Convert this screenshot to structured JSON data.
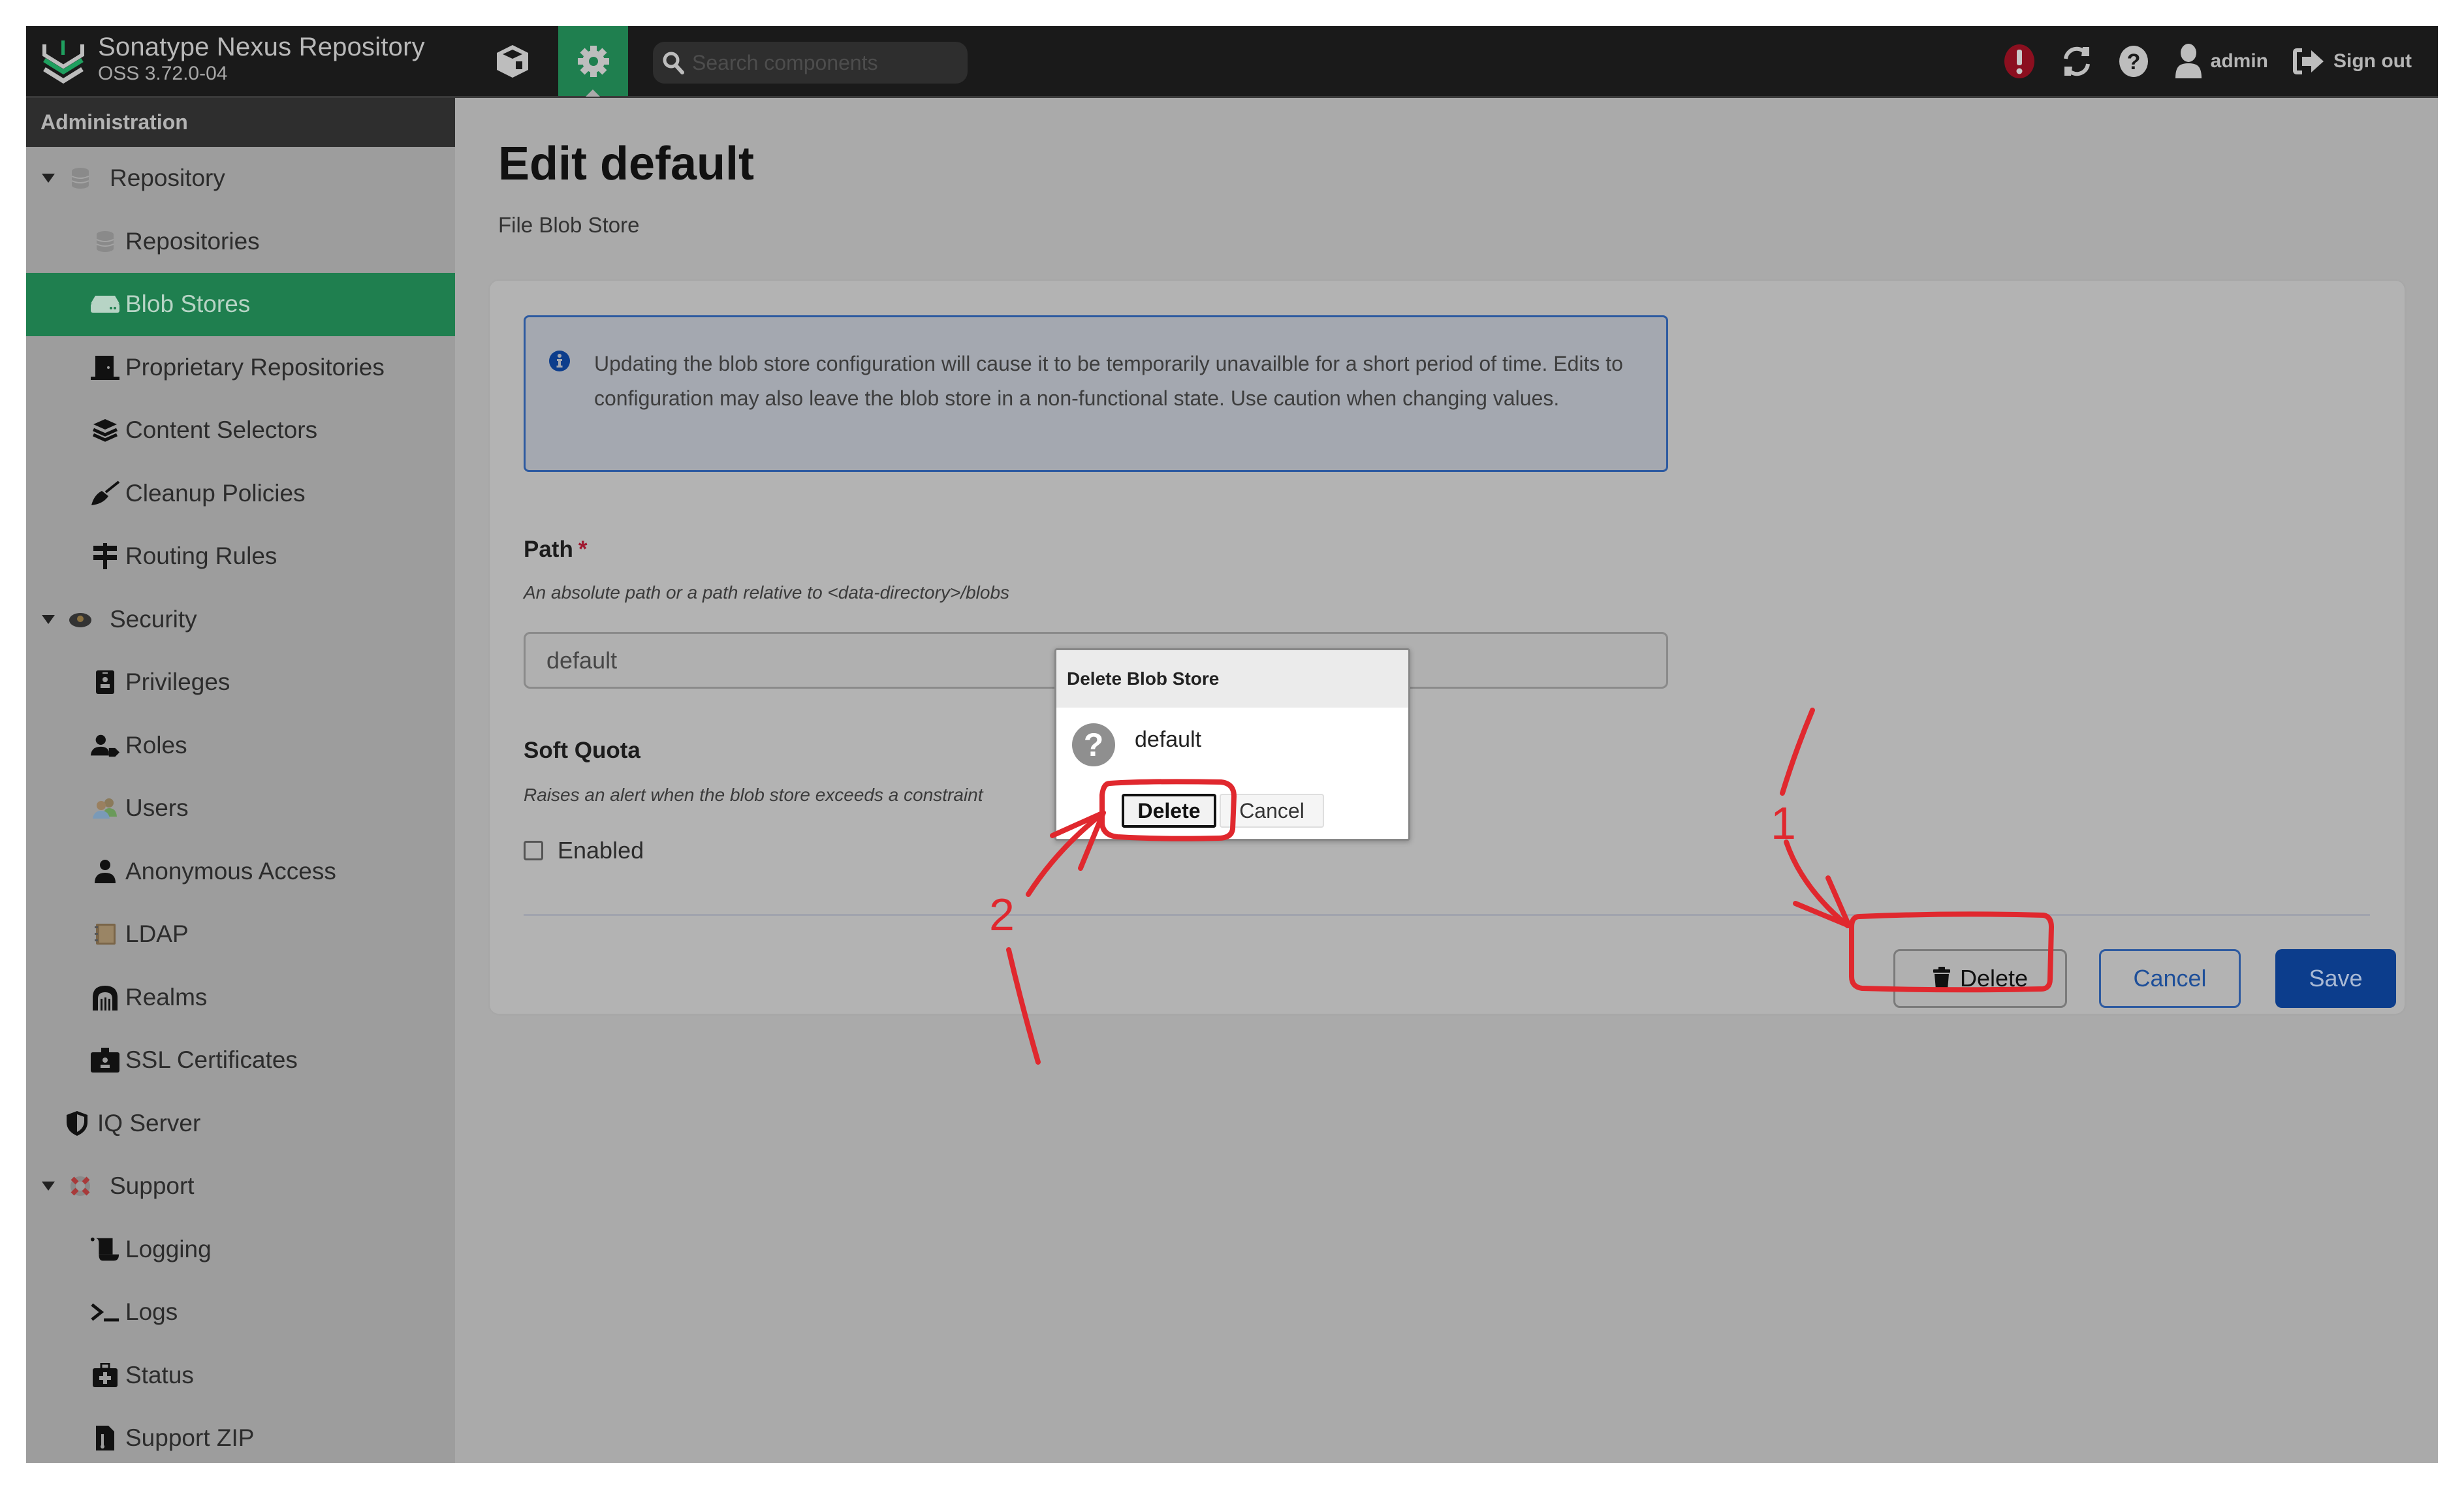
{
  "header": {
    "brand_title": "Sonatype Nexus Repository",
    "brand_version": "OSS 3.72.0-04",
    "search_placeholder": "Search components",
    "user_label": "admin",
    "signout_label": "Sign out",
    "icons": [
      "cube-icon",
      "gear-icon",
      "search-icon",
      "alert-icon",
      "refresh-icon",
      "help-icon",
      "user-icon",
      "sign-out-icon"
    ],
    "alert_color": "#8b0f1f",
    "admin_active_color": "#1f7f4f"
  },
  "sidebar": {
    "header": "Administration",
    "items": [
      {
        "label": "Repository",
        "type": "group",
        "icon": "database-icon",
        "expanded": true
      },
      {
        "label": "Repositories",
        "type": "child",
        "icon": "database-icon"
      },
      {
        "label": "Blob Stores",
        "type": "child",
        "icon": "hdd-icon",
        "active": true
      },
      {
        "label": "Proprietary Repositories",
        "type": "child",
        "icon": "door-icon"
      },
      {
        "label": "Content Selectors",
        "type": "child",
        "icon": "layers-icon"
      },
      {
        "label": "Cleanup Policies",
        "type": "child",
        "icon": "broom-icon"
      },
      {
        "label": "Routing Rules",
        "type": "child",
        "icon": "signpost-icon"
      },
      {
        "label": "Security",
        "type": "group",
        "icon": "security-icon",
        "expanded": true
      },
      {
        "label": "Privileges",
        "type": "child",
        "icon": "id-badge-icon"
      },
      {
        "label": "Roles",
        "type": "child",
        "icon": "user-tag-icon"
      },
      {
        "label": "Users",
        "type": "child",
        "icon": "users-icon"
      },
      {
        "label": "Anonymous Access",
        "type": "child",
        "icon": "user-icon"
      },
      {
        "label": "LDAP",
        "type": "child",
        "icon": "address-book-icon"
      },
      {
        "label": "Realms",
        "type": "child",
        "icon": "archway-icon"
      },
      {
        "label": "SSL Certificates",
        "type": "child",
        "icon": "id-card-icon"
      },
      {
        "label": "IQ Server",
        "type": "top",
        "icon": "shield-icon"
      },
      {
        "label": "Support",
        "type": "group",
        "icon": "lifebuoy-icon",
        "expanded": true
      },
      {
        "label": "Logging",
        "type": "child",
        "icon": "scroll-icon"
      },
      {
        "label": "Logs",
        "type": "child",
        "icon": "terminal-icon"
      },
      {
        "label": "Status",
        "type": "child",
        "icon": "medkit-icon"
      },
      {
        "label": "Support ZIP",
        "type": "child",
        "icon": "file-zip-icon"
      }
    ]
  },
  "main": {
    "title": "Edit default",
    "subtitle": "File Blob Store",
    "info_message": "Updating the blob store configuration will cause it to be temporarily unavailble for a short period of time. Edits to configuration may also leave the blob store in a non-functional state. Use caution when changing values.",
    "path": {
      "label": "Path",
      "required_marker": "*",
      "help": "An absolute path or a path relative to <data-directory>/blobs",
      "value": "default"
    },
    "soft_quota": {
      "label": "Soft Quota",
      "help": "Raises an alert when the blob store exceeds a constraint",
      "checkbox_label": "Enabled",
      "checked": false
    },
    "buttons": {
      "delete": "Delete",
      "cancel": "Cancel",
      "save": "Save"
    },
    "primary_color": "#0c3d8c"
  },
  "dialog": {
    "title": "Delete Blob Store",
    "message": "default",
    "delete_label": "Delete",
    "cancel_label": "Cancel"
  },
  "annotations": {
    "step1": "1",
    "step2": "2",
    "color": "#e0282e"
  }
}
